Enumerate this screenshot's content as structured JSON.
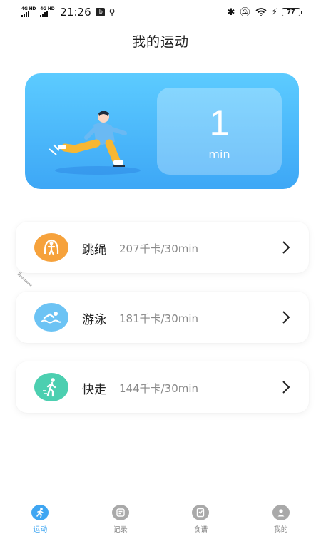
{
  "status_bar": {
    "network_1": "4G HD",
    "network_2": "4G HD",
    "time": "21:26",
    "badge": "Ib",
    "battery": "77"
  },
  "page": {
    "title": "我的运动"
  },
  "hero": {
    "value": "1",
    "unit": "min"
  },
  "sports": [
    {
      "name": "跳绳",
      "calories": "207千卡/30min",
      "icon": "jump-rope-icon",
      "color": "#f6a23c"
    },
    {
      "name": "游泳",
      "calories": "181千卡/30min",
      "icon": "swimming-icon",
      "color": "#6cc3f4"
    },
    {
      "name": "快走",
      "calories": "144千卡/30min",
      "icon": "walking-icon",
      "color": "#4ccfb0"
    }
  ],
  "tabs": [
    {
      "label": "运动",
      "icon": "sport-icon",
      "active": true
    },
    {
      "label": "记录",
      "icon": "record-icon",
      "active": false
    },
    {
      "label": "食谱",
      "icon": "recipe-icon",
      "active": false
    },
    {
      "label": "我的",
      "icon": "profile-icon",
      "active": false
    }
  ],
  "colors": {
    "accent": "#3fa6f2",
    "hero_top": "#5ccbff",
    "hero_bottom": "#3da7f6",
    "inactive_tab": "#a9a9a9"
  }
}
